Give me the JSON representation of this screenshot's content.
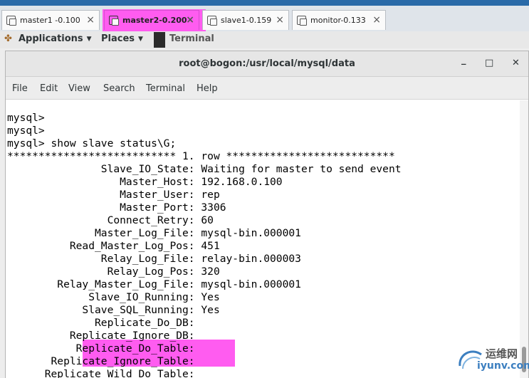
{
  "vm_tabs": [
    {
      "label": "master1 -0.100",
      "active": false
    },
    {
      "label": "master2-0.200",
      "active": true
    },
    {
      "label": "slave1-0.159",
      "active": false
    },
    {
      "label": "monitor-0.133",
      "active": false
    }
  ],
  "tab_close_glyph": "×",
  "gnome_bar": {
    "applications": "Applications",
    "places": "Places",
    "terminal": "Terminal",
    "caret": "▼"
  },
  "window": {
    "title": "root@bogon:/usr/local/mysql/data",
    "minimize": "_",
    "maximize": "□",
    "close": "✕"
  },
  "menu": [
    "File",
    "Edit",
    "View",
    "Search",
    "Terminal",
    "Help"
  ],
  "terminal_lines": [
    "mysql>",
    "mysql>",
    "mysql> show slave status\\G;",
    "*************************** 1. row ***************************",
    "               Slave_IO_State: Waiting for master to send event",
    "                  Master_Host: 192.168.0.100",
    "                  Master_User: rep",
    "                  Master_Port: 3306",
    "                Connect_Retry: 60",
    "              Master_Log_File: mysql-bin.000001",
    "          Read_Master_Log_Pos: 451",
    "               Relay_Log_File: relay-bin.000003",
    "                Relay_Log_Pos: 320",
    "        Relay_Master_Log_File: mysql-bin.000001",
    "             Slave_IO_Running: Yes",
    "            Slave_SQL_Running: Yes",
    "              Replicate_Do_DB:",
    "          Replicate_Ignore_DB:",
    "           Replicate_Do_Table:",
    "       Replicate_Ignore_Table:",
    "      Replicate_Wild_Do_Table:"
  ],
  "highlight_color": "#ff5cf0",
  "watermark": {
    "line1": "运维网",
    "line2": "iyunv.com"
  }
}
